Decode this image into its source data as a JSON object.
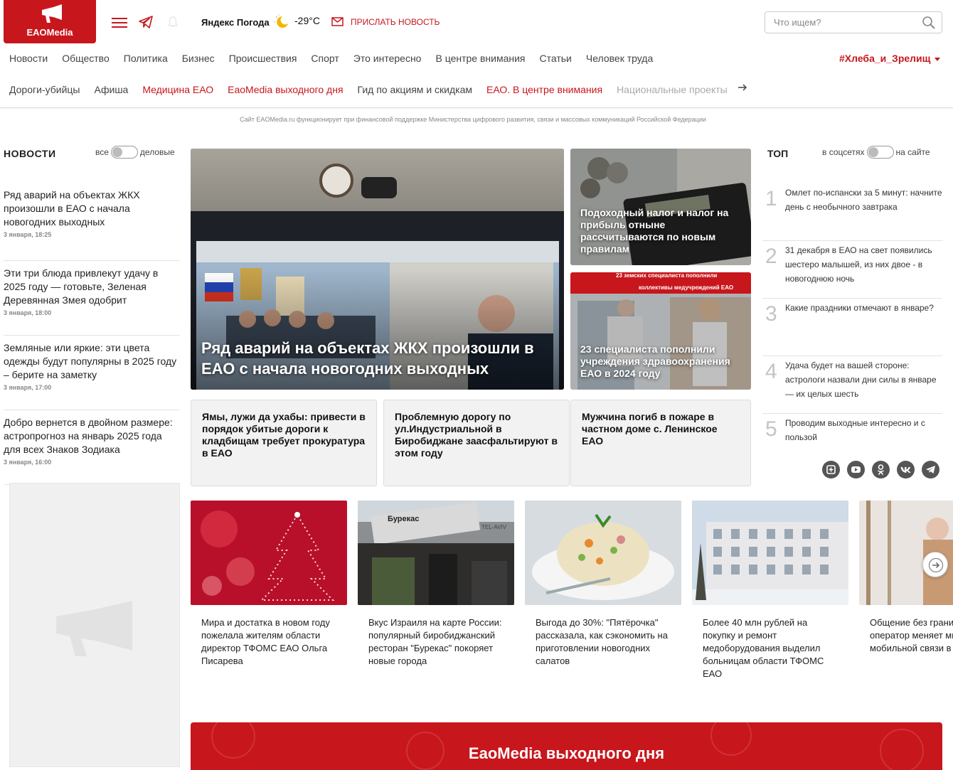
{
  "header": {
    "logo_text": "EAOMedia",
    "weather_brand": "Яндекс Погода",
    "weather_temp": "-29°C",
    "send_news": "ПРИСЛАТЬ НОВОСТЬ",
    "search_placeholder": "Что ищем?"
  },
  "nav_primary": [
    "Новости",
    "Общество",
    "Политика",
    "Бизнес",
    "Происшествия",
    "Спорт",
    "Это интересно",
    "В центре внимания",
    "Статьи",
    "Человек труда"
  ],
  "hashtag": "#Хлеба_и_Зрелищ",
  "nav_secondary": [
    {
      "label": "Дороги-убийцы",
      "style": "normal"
    },
    {
      "label": "Афиша",
      "style": "normal"
    },
    {
      "label": "Медицина ЕАО",
      "style": "red"
    },
    {
      "label": "EaoMedia выходного дня",
      "style": "red"
    },
    {
      "label": "Гид по акциям и скидкам",
      "style": "normal"
    },
    {
      "label": "ЕАО. В центре внимания",
      "style": "red"
    },
    {
      "label": "Национальные проекты",
      "style": "fade"
    }
  ],
  "notice": "Сайт EAOMedia.ru функционирует при финансовой поддержке Министерства цифрового развития, связи и массовых коммуникаций Российской Федерации",
  "news": {
    "title": "НОВОСТИ",
    "toggle_left": "все",
    "toggle_right": "деловые",
    "items": [
      {
        "title": "Ряд аварий на объектах ЖКХ произошли в ЕАО с начала новогодних выходных",
        "date": "3 января, 18:25"
      },
      {
        "title": "Эти три блюда привлекут удачу в 2025 году — готовьте, Зеленая Деревянная Змея одобрит",
        "date": "3 января, 18:00"
      },
      {
        "title": "Земляные или яркие: эти цвета одежды будут популярны в 2025 году – берите на заметку",
        "date": "3 января, 17:00"
      },
      {
        "title": "Добро вернется в двойном размере: астропрогноз на январь 2025 года для всех Знаков Зодиака",
        "date": "3 января, 16:00"
      }
    ]
  },
  "feature": {
    "main": "Ряд аварий на объектах ЖКХ произошли в ЕАО с начала новогодних выходных",
    "side1": "Подоходный налог и налог на прибыль отныне рассчитываются по новым правилам",
    "side2": "23 специалиста пополнили учреждения здравоохранения ЕАО в 2024 году",
    "side2_banner_top": "23 земских специалиста пополнили",
    "side2_banner_bottom": "коллективы медучреждений ЕАО",
    "boxes": [
      "Ямы, лужи да ухабы: привести в порядок убитые дороги к кладбищам требует прокуратура в ЕАО",
      "Проблемную дорогу по ул.Индустриальной в Биробиджане заасфальтируют в этом году",
      "Мужчина погиб в пожаре в частном доме с. Ленинское ЕАО"
    ]
  },
  "top": {
    "title": "ТОП",
    "toggle_left": "в соцсетях",
    "toggle_right": "на сайте",
    "items": [
      {
        "num": "1",
        "title": "Омлет по-испански за 5 минут: начните день с необычного завтрака"
      },
      {
        "num": "2",
        "title": "31 декабря в ЕАО на свет появились шестеро малышей, из них двое - в новогоднюю ночь"
      },
      {
        "num": "3",
        "title": "Какие праздники отмечают в январе?"
      },
      {
        "num": "4",
        "title": "Удача будет на вашей стороне: астрологи назвали дни силы в январе — их целых шесть"
      },
      {
        "num": "5",
        "title": "Проводим выходные интересно и с пользой"
      }
    ]
  },
  "socials": [
    "plus-circle-icon",
    "youtube-icon",
    "odnoklassniki-icon",
    "vk-icon",
    "telegram-icon"
  ],
  "carousel": [
    {
      "title": "Мира и достатка в новом году пожелала жителям области директор ТФОМС ЕАО Ольга Писарева"
    },
    {
      "title": "Вкус Израиля на карте России: популярный биробиджанский ресторан \"Бурекас\" покоряет новые города",
      "sign": "Бурекас",
      "sign2": "TEL-AVIV"
    },
    {
      "title": "Выгода до 30%: \"Пятёрочка\" рассказала, как сэкономить на приготовлении новогодних салатов"
    },
    {
      "title": "Более 40 млн рублей на покупку и ремонт медоборудования выделил больницам области ТФОМС ЕАО"
    },
    {
      "title": "Общение без границ: сотовый оператор меняет мир мобильной связи в ЕАО"
    }
  ],
  "banner": "EaoMedia выходного дня",
  "colors": {
    "brand": "#c8161d"
  }
}
